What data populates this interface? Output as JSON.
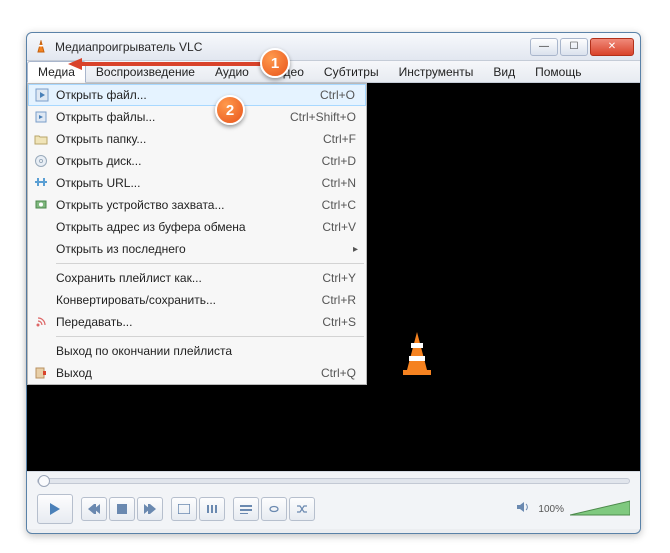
{
  "window": {
    "title": "Медиапроигрыватель VLC"
  },
  "menubar": {
    "items": [
      {
        "label": "Медиа",
        "active": true
      },
      {
        "label": "Воспроизведение"
      },
      {
        "label": "Аудио"
      },
      {
        "label": "Видео"
      },
      {
        "label": "Субтитры"
      },
      {
        "label": "Инструменты"
      },
      {
        "label": "Вид"
      },
      {
        "label": "Помощь"
      }
    ]
  },
  "dropdown": {
    "items": [
      {
        "icon": "play-file",
        "label": "Открыть файл...",
        "shortcut": "Ctrl+O",
        "highlighted": true
      },
      {
        "icon": "play-files",
        "label": "Открыть файлы...",
        "shortcut": "Ctrl+Shift+O"
      },
      {
        "icon": "folder",
        "label": "Открыть папку...",
        "shortcut": "Ctrl+F"
      },
      {
        "icon": "disc",
        "label": "Открыть диск...",
        "shortcut": "Ctrl+D"
      },
      {
        "icon": "network",
        "label": "Открыть URL...",
        "shortcut": "Ctrl+N"
      },
      {
        "icon": "capture",
        "label": "Открыть устройство захвата...",
        "shortcut": "Ctrl+C"
      },
      {
        "icon": "",
        "label": "Открыть адрес из буфера обмена",
        "shortcut": "Ctrl+V"
      },
      {
        "icon": "",
        "label": "Открыть из последнего",
        "submenu": true
      },
      {
        "sep": true
      },
      {
        "icon": "",
        "label": "Сохранить плейлист как...",
        "shortcut": "Ctrl+Y"
      },
      {
        "icon": "",
        "label": "Конвертировать/сохранить...",
        "shortcut": "Ctrl+R"
      },
      {
        "icon": "stream",
        "label": "Передавать...",
        "shortcut": "Ctrl+S"
      },
      {
        "sep": true
      },
      {
        "icon": "",
        "label": "Выход по окончании плейлиста"
      },
      {
        "icon": "quit",
        "label": "Выход",
        "shortcut": "Ctrl+Q"
      }
    ]
  },
  "controls": {
    "volume_label": "100%"
  },
  "callouts": {
    "c1": "1",
    "c2": "2"
  }
}
